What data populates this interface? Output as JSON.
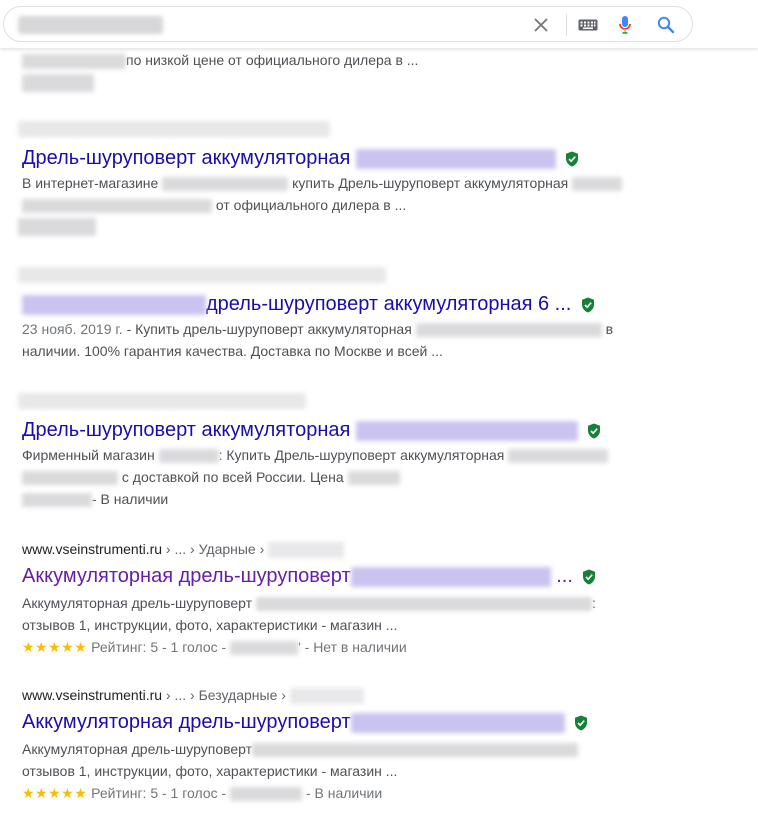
{
  "search": {
    "value": "",
    "icons": {
      "clear": "close-icon",
      "keyboard": "keyboard-icon",
      "voice": "microphone-icon",
      "search": "search-icon"
    }
  },
  "results": [
    {
      "snippet_lines": [
        "по низкой цене от официального дилера в ..."
      ]
    },
    {
      "title": "Дрель-шуруповерт аккумуляторная",
      "snippet_prefix": "В интернет-магазине",
      "snippet_mid": "купить Дрель-шуруповерт аккумуляторная",
      "snippet_line2": "от официального дилера в ..."
    },
    {
      "title": "дрель-шуруповерт аккумуляторная 6 ...",
      "date": "23 нояб. 2019 г.",
      "snippet_l1": " - Купить дрель-шуруповерт аккумуляторная",
      "snippet_l1_end": "в",
      "snippet_l2": "наличии. 100% гарантия качества. Доставка по Москве и всей ..."
    },
    {
      "title": "Дрель-шуруповерт аккумуляторная",
      "snippet_l1a": "Фирменный магазин",
      "snippet_l1b": ": Купить Дрель-шуруповерт аккумуляторная",
      "snippet_l2": "с доставкой по всей России. Цена",
      "snippet_l3": "- В наличии"
    },
    {
      "cite_domain": "www.vseinstrumenti.ru",
      "cite_path": " › ... › Ударные › ",
      "title": "Аккумуляторная дрель-шуруповерт",
      "title_end": "...",
      "snippet_l1": "Аккумуляторная дрель-шуруповерт",
      "snippet_l1_end": ":",
      "snippet_l2": "отзывов 1, инструкции, фото, характеристики - магазин ...",
      "stars": "★★★★★",
      "rating": " Рейтинг: 5 - 1 голос - ",
      "availability": "' - Нет в наличии"
    },
    {
      "cite_domain": "www.vseinstrumenti.ru",
      "cite_path": " › ... › Безударные › ",
      "title": "Аккумуляторная дрель-шуруповерт",
      "snippet_l1": "Аккумуляторная дрель-шуруповерт",
      "snippet_l2": "отзывов 1, инструкции, фото, характеристики - магазин ...",
      "stars": "★★★★★",
      "rating": " Рейтинг: 5 - 1 голос - ",
      "availability": " - В наличии"
    }
  ]
}
